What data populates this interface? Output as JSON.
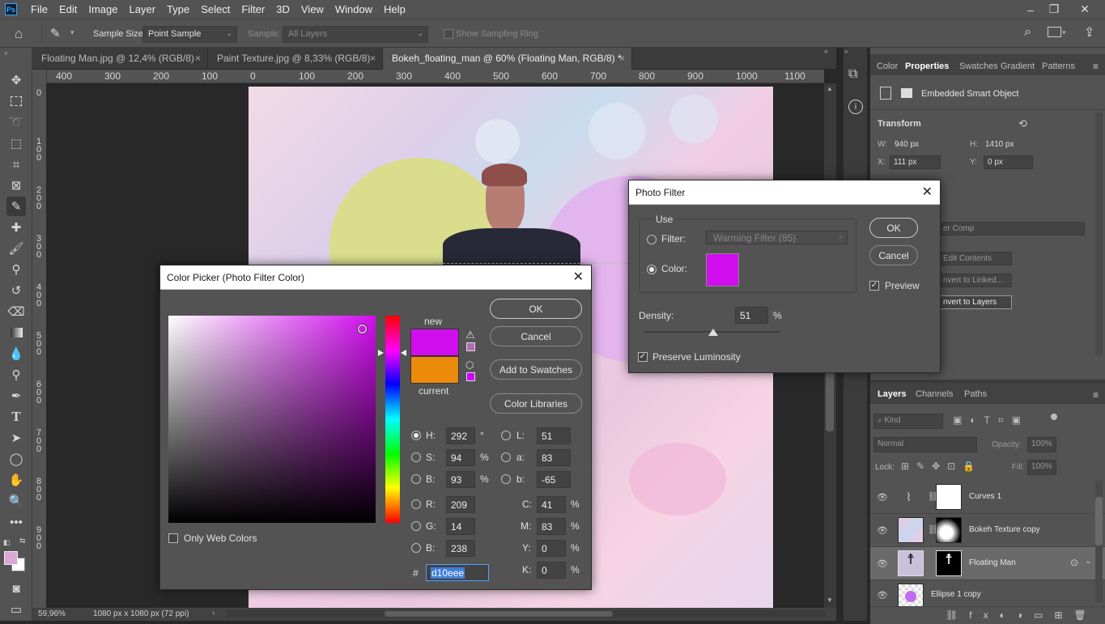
{
  "menubar": {
    "logo": "Ps",
    "items": [
      "File",
      "Edit",
      "Image",
      "Layer",
      "Type",
      "Select",
      "Filter",
      "3D",
      "View",
      "Window",
      "Help"
    ]
  },
  "options": {
    "sample_size_label": "Sample Size:",
    "sample_size_value": "Point Sample",
    "sample_label": "Sample:",
    "sample_value": "All Layers",
    "show_ring_label": "Show Sampling Ring"
  },
  "tabs": [
    {
      "label": "Floating Man.jpg @ 12,4% (RGB/8)"
    },
    {
      "label": "Paint Texture.jpg @ 8,33% (RGB/8)"
    },
    {
      "label": "Bokeh_floating_man @ 60% (Floating Man, RGB/8) *"
    }
  ],
  "ruler": {
    "h": [
      "400",
      "300",
      "200",
      "100",
      "0",
      "100",
      "200",
      "300",
      "400",
      "500",
      "600",
      "700",
      "800",
      "900",
      "1000",
      "1100"
    ],
    "v": [
      "0",
      "1 0 0",
      "2 0 0",
      "3 0 0",
      "4 0 0",
      "5 0 0",
      "6 0 0",
      "7 0 0",
      "8 0 0",
      "9 0 0"
    ]
  },
  "status": {
    "zoom": "59,96%",
    "doc": "1080 px x 1080 px (72 ppi)"
  },
  "properties": {
    "tabs": [
      "Color",
      "Properties",
      "Swatches",
      "Gradient",
      "Patterns"
    ],
    "object_type": "Embedded Smart Object",
    "transform_label": "Transform",
    "w_label": "W:",
    "w": "940 px",
    "h_label": "H:",
    "h": "1410 px",
    "x_label": "X:",
    "x": "111 px",
    "y_label": "Y:",
    "y": "0 px",
    "layer_comp": "er Comp",
    "edit_contents": "Edit Contents",
    "convert_linked": "nvert to Linked...",
    "convert_layers": "nvert to Layers"
  },
  "layers_panel": {
    "tabs": [
      "Layers",
      "Channels",
      "Paths"
    ],
    "kind": "Kind",
    "blend": "Normal",
    "opacity_label": "Opacity:",
    "opacity": "100%",
    "lock_label": "Lock:",
    "fill_label": "Fill:",
    "fill": "100%",
    "layers": [
      {
        "name": "Curves 1"
      },
      {
        "name": "Bokeh Texture copy"
      },
      {
        "name": "Floating Man"
      },
      {
        "name": "Ellipse 1 copy"
      }
    ]
  },
  "photo_filter": {
    "title": "Photo Filter",
    "use_label": "Use",
    "filter_label": "Filter:",
    "filter_value": "Warming Filter (85)",
    "color_label": "Color:",
    "density_label": "Density:",
    "density": "51",
    "density_unit": "%",
    "density_fraction": 0.51,
    "preserve_label": "Preserve Luminosity",
    "ok": "OK",
    "cancel": "Cancel",
    "preview": "Preview",
    "color_hex": "#d10eee"
  },
  "color_picker": {
    "title": "Color Picker (Photo Filter Color)",
    "new_label": "new",
    "current_label": "current",
    "new_color": "#d10eee",
    "current_color": "#ec8a0c",
    "ok": "OK",
    "cancel": "Cancel",
    "add_swatches": "Add to Swatches",
    "color_libraries": "Color Libraries",
    "only_web": "Only Web Colors",
    "fields": {
      "H": {
        "label": "H:",
        "value": "292",
        "unit": "°"
      },
      "S": {
        "label": "S:",
        "value": "94",
        "unit": "%"
      },
      "Bv": {
        "label": "B:",
        "value": "93",
        "unit": "%"
      },
      "R": {
        "label": "R:",
        "value": "209"
      },
      "G": {
        "label": "G:",
        "value": "14"
      },
      "Bc": {
        "label": "B:",
        "value": "238"
      },
      "L": {
        "label": "L:",
        "value": "51"
      },
      "a": {
        "label": "a:",
        "value": "83"
      },
      "b": {
        "label": "b:",
        "value": "-65"
      },
      "C": {
        "label": "C:",
        "value": "41",
        "unit": "%"
      },
      "M": {
        "label": "M:",
        "value": "83",
        "unit": "%"
      },
      "Y": {
        "label": "Y:",
        "value": "0",
        "unit": "%"
      },
      "K": {
        "label": "K:",
        "value": "0",
        "unit": "%"
      }
    },
    "hash": "#",
    "hex": "d10eee"
  }
}
